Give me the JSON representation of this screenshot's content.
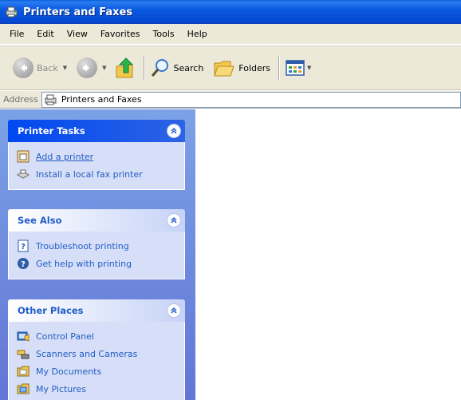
{
  "window": {
    "title": "Printers and Faxes"
  },
  "menu": {
    "items": [
      "File",
      "Edit",
      "View",
      "Favorites",
      "Tools",
      "Help"
    ]
  },
  "toolbar": {
    "back_label": "Back",
    "search_label": "Search",
    "folders_label": "Folders"
  },
  "address": {
    "label": "Address",
    "value": "Printers and Faxes"
  },
  "panels": {
    "printer_tasks": {
      "title": "Printer Tasks",
      "items": [
        "Add a printer",
        "Install a local fax printer"
      ]
    },
    "see_also": {
      "title": "See Also",
      "items": [
        "Troubleshoot printing",
        "Get help with printing"
      ]
    },
    "other_places": {
      "title": "Other Places",
      "items": [
        "Control Panel",
        "Scanners and Cameras",
        "My Documents",
        "My Pictures"
      ]
    }
  },
  "colors": {
    "titlebar": "#0a5adf",
    "link": "#215dc6",
    "pane_bg": "#7ba2e7",
    "panel_body": "#d6dff7"
  }
}
